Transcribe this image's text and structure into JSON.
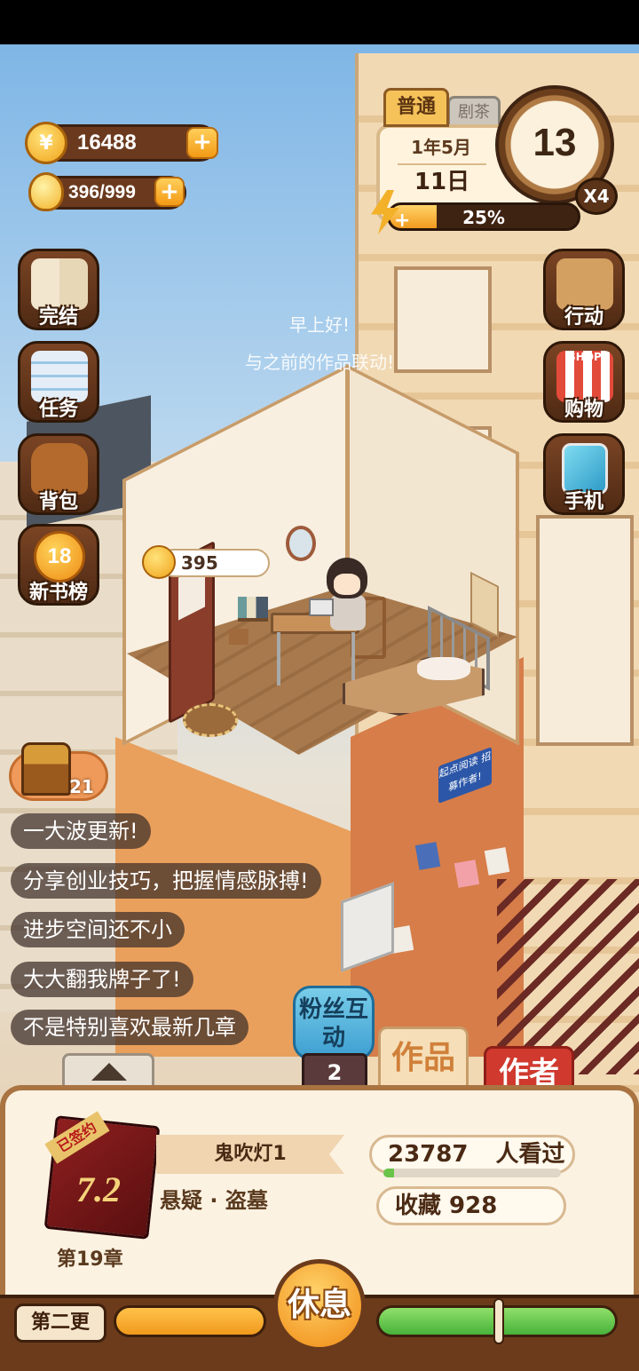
{
  "resources": {
    "coins": "16488",
    "inspiration": "396/999"
  },
  "date": {
    "mode_tab": "普通",
    "mode_tab_other": "剧茶",
    "year_month": "1年5月",
    "day": "11日",
    "hour": "13",
    "speed": "X4",
    "energy_percent_text": "25%",
    "energy_fraction": 0.25
  },
  "left_menu": [
    {
      "label": "完结",
      "icon": "book-icon"
    },
    {
      "label": "任务",
      "icon": "checklist-icon"
    },
    {
      "label": "背包",
      "icon": "backpack-icon"
    },
    {
      "label": "新书榜",
      "icon": "ranking-medal-icon",
      "badge": "18"
    }
  ],
  "right_menu": [
    {
      "label": "行动",
      "icon": "door-arrow-icon"
    },
    {
      "label": "购物",
      "icon": "shop-icon",
      "icon_text": "SHOP"
    },
    {
      "label": "手机",
      "icon": "phone-icon"
    }
  ],
  "greeting": [
    "早上好!",
    "与之前的作品联动!"
  ],
  "room": {
    "coin_bubble": "395",
    "wall_sign": "起点阅读 招募作者!"
  },
  "chest": {
    "count": "21"
  },
  "feed": [
    "一大波更新!",
    "分享创业技巧，把握情感脉搏!",
    "进步空间还不小",
    "大大翻我牌子了!",
    "不是特别喜欢最新几章"
  ],
  "fan_interact": {
    "label": "粉丝互动",
    "count": "2"
  },
  "tabs": {
    "works": "作品",
    "author": "作者"
  },
  "book": {
    "ribbon": "已签约",
    "score": "7.2",
    "title": "鬼吹灯1",
    "genre": "悬疑 · 盗墓",
    "chapter": "第19章",
    "views_number": "23787",
    "views_label": "人看过",
    "favorites": "收藏 928"
  },
  "bottom": {
    "update_label": "第二更",
    "rest_label": "休息"
  },
  "colors": {
    "brown_dark": "#6b3b1c",
    "orange": "#f09a1c",
    "green": "#47b23a",
    "author_red": "#d0392e"
  }
}
